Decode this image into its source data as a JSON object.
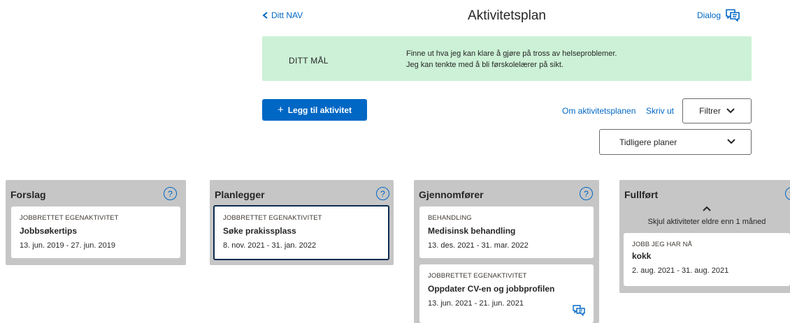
{
  "header": {
    "back_label": "Ditt NAV",
    "title": "Aktivitetsplan",
    "dialog_label": "Dialog"
  },
  "goal": {
    "label": "DITT MÅL",
    "line1": "Finne ut hva jeg kan klare å gjøre på tross av helseproblemer.",
    "line2": "Jeg kan tenkte med å bli førskolelærer på sikt."
  },
  "toolbar": {
    "add_label": "Legg til aktivitet",
    "about_label": "Om aktivitetsplanen",
    "print_label": "Skriv ut",
    "filter_label": "Filtrer",
    "previous_plans_label": "Tidligere planer"
  },
  "columns": [
    {
      "title": "Forslag",
      "cards": [
        {
          "type": "JOBBRETTET EGENAKTIVITET",
          "title": "Jobbsøkertips",
          "dates": "13. jun. 2019 - 27. jun. 2019"
        }
      ]
    },
    {
      "title": "Planlegger",
      "cards": [
        {
          "type": "JOBBRETTET EGENAKTIVITET",
          "title": "Søke prakissplass",
          "dates": "8. nov. 2021 - 31. jan. 2022"
        }
      ]
    },
    {
      "title": "Gjennomfører",
      "cards": [
        {
          "type": "BEHANDLING",
          "title": "Medisinsk behandling",
          "dates": "13. des. 2021 - 31. mar. 2022"
        },
        {
          "type": "JOBBRETTET EGENAKTIVITET",
          "title": "Oppdater CV-en og jobbprofilen",
          "dates": "13. jun. 2021 - 21. jun. 2021"
        }
      ]
    },
    {
      "title": "Fullført",
      "toggle_label": "Skjul aktiviteter eldre enn 1 måned",
      "cards": [
        {
          "type": "JOBB JEG HAR NÅ",
          "title": "kokk",
          "dates": "2. aug. 2021 - 31. aug. 2021"
        }
      ]
    }
  ],
  "colors": {
    "link": "#0067c5",
    "goal_background": "#ccf1d6",
    "column_background": "#c6c6c6",
    "selected_border": "#0c2b50"
  },
  "icons": {
    "back": "chevron-left-icon",
    "dialog": "dialog-bubbles-icon",
    "plus": "plus-icon",
    "filter": "chevron-down-icon",
    "help": "help-circle-icon",
    "toggle": "chevron-up-icon"
  }
}
